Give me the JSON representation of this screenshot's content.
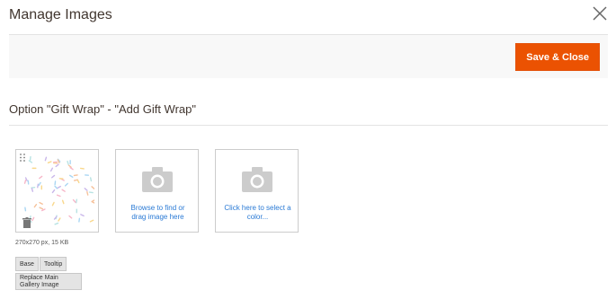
{
  "modal": {
    "title": "Manage Images",
    "close_icon": "close-icon"
  },
  "toolbar": {
    "save_close_label": "Save & Close"
  },
  "option": {
    "heading": "Option \"Gift Wrap\" - \"Add Gift Wrap\""
  },
  "images": {
    "main": {
      "meta": "270x270 px, 15 KB",
      "roles": [
        "Base",
        "Tooltip"
      ],
      "replace_label": "Replace Main Gallery Image"
    },
    "upload": {
      "label": "Browse to find or drag image here",
      "icon": "camera-icon"
    },
    "color": {
      "label": "Click here to select a color...",
      "icon": "camera-icon"
    }
  },
  "colors": {
    "accent": "#eb5202",
    "link": "#2a7ad5",
    "confetti": [
      "#f7b6c8",
      "#f9d88c",
      "#b8e3e3",
      "#c9b7ea",
      "#a9d6f3",
      "#f6c29b"
    ]
  }
}
